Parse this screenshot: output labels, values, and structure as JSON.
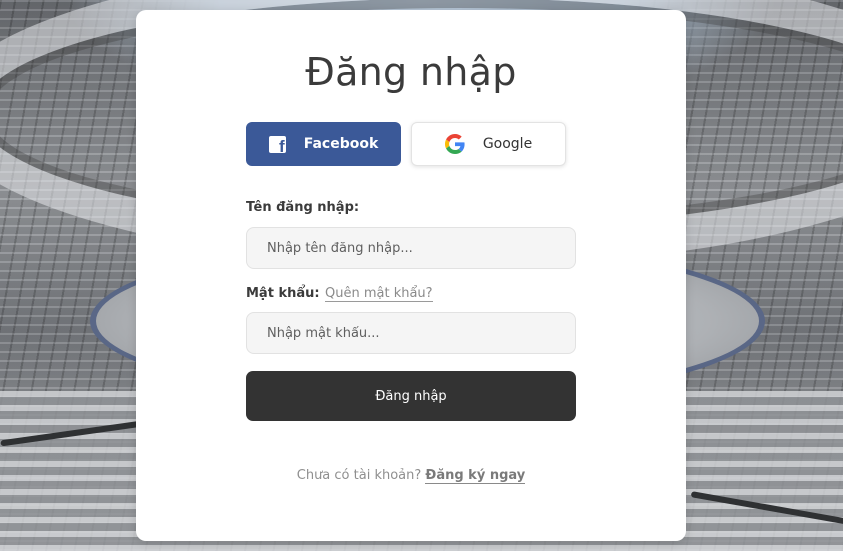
{
  "colors": {
    "facebook": "#3b5998",
    "submit_bg": "#333333",
    "card_bg": "#ffffff"
  },
  "login": {
    "title": "Đăng nhập",
    "facebook_label": "Facebook",
    "google_label": "Google",
    "username_label": "Tên đăng nhập:",
    "username_placeholder": "Nhập tên đăng nhập...",
    "password_label": "Mật khẩu:",
    "forgot_link": "Quên mật khẩu?",
    "password_placeholder": "Nhập mật khẩu...",
    "submit_label": "Đăng nhập",
    "no_account_text": "Chưa có tài khoản?",
    "signup_link": "Đăng ký ngay"
  },
  "icons": {
    "facebook": "facebook-icon",
    "google": "google-icon"
  }
}
